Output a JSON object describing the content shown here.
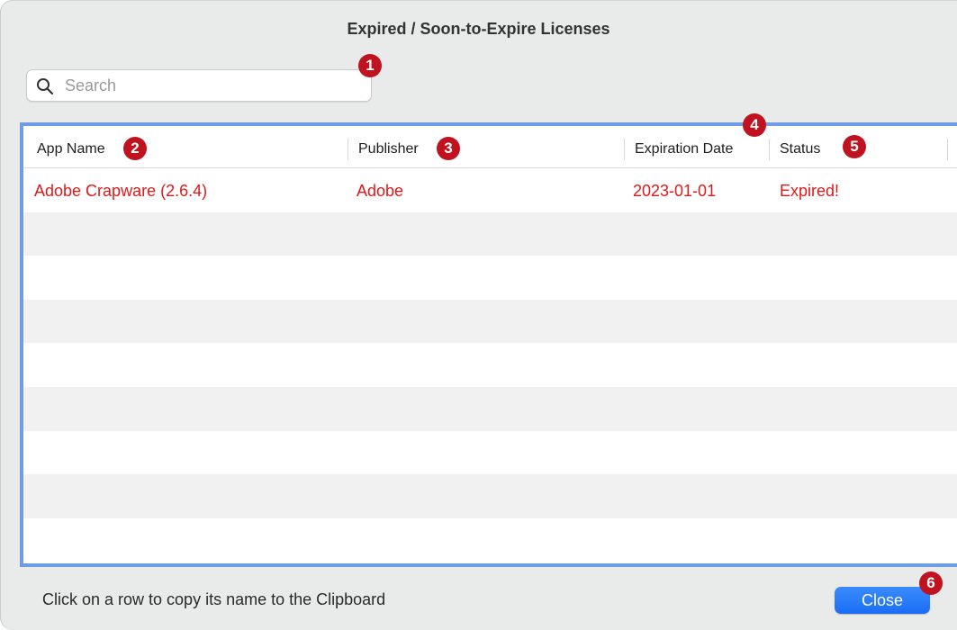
{
  "window": {
    "title": "Expired / Soon-to-Expire Licenses"
  },
  "search": {
    "placeholder": "Search",
    "value": ""
  },
  "table": {
    "columns": [
      "App Name",
      "Publisher",
      "Expiration Date",
      "Status"
    ],
    "rows": [
      {
        "app_name": "Adobe Crapware (2.6.4)",
        "publisher": "Adobe",
        "expiration_date": "2023-01-01",
        "status": "Expired!"
      }
    ],
    "row_text_color": "#e01a1a",
    "focus_border_color": "#6f9ce6"
  },
  "footer": {
    "hint": "Click on a row to copy its name to the Clipboard",
    "close_label": "Close"
  },
  "annotations": [
    "1",
    "2",
    "3",
    "4",
    "5",
    "6"
  ],
  "colors": {
    "badge": "#c1121f",
    "button": "#1a6ef5"
  }
}
